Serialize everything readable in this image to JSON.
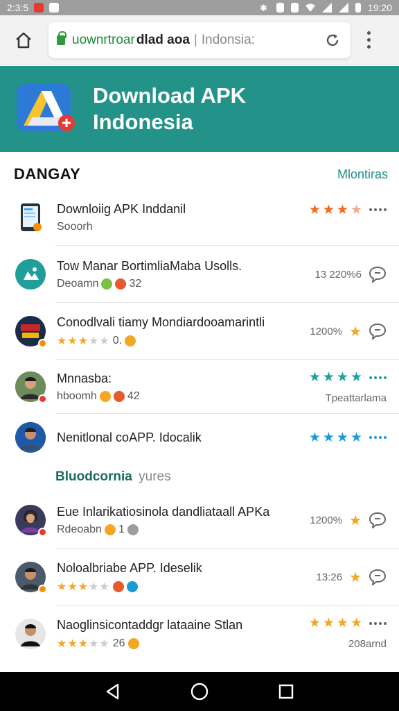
{
  "status_bar": {
    "time_left": "2:3:5",
    "time_right": "19:20"
  },
  "browser": {
    "url_host": "uownrtroar",
    "url_path": "dlad aoa",
    "url_sep": "|",
    "url_title": "Indonsia:"
  },
  "hero": {
    "title_line1": "Download APK",
    "title_line2": "Indonesia"
  },
  "section": {
    "title": "DANGAY",
    "link": "Mlontiras"
  },
  "list1": [
    {
      "title": "Downloiig APK Inddanil",
      "sub": "Sooorh",
      "right_type": "stars-dots",
      "stars": 3.5
    },
    {
      "title": "Tow Manar BortimliaMaba Usolls.",
      "sub": "Deoamn",
      "sub_num": "32",
      "meta": "13 220%6"
    },
    {
      "title": "Conodlvali tiamy Mondiardooamarintli",
      "sub_num": "0.",
      "meta": "1200%"
    },
    {
      "title": "Mnnasba:",
      "sub": "hboomh",
      "sub_num": "42",
      "meta": "Tpeattarlama"
    },
    {
      "title": "Nenitlonal coAPP. Idocalik"
    }
  ],
  "subheading": {
    "strong": "Bluodcornia",
    "light": "yures"
  },
  "list2": [
    {
      "title": "Eue Inlarikatiosinola dandliataall APKa",
      "sub": "Rdeoabn",
      "sub_num": "1",
      "meta": "1200%"
    },
    {
      "title": "Noloalbriabe APP. Ideselik",
      "meta": "13:26"
    },
    {
      "title": "Naoglinsicontaddgr lataaine Stlan",
      "sub_num": "26",
      "meta": "208arnd"
    }
  ],
  "colors": {
    "accent": "#23938a",
    "star": "#f5a623",
    "orange_star": "#ef6c1a",
    "teal_star": "#1aa1a0",
    "blue_star": "#1a9ad6"
  },
  "icons": [
    "home-icon",
    "lock-icon",
    "reload-icon",
    "overflow-menu-icon",
    "back-icon",
    "home-circle-icon",
    "recents-icon",
    "chat-icon"
  ]
}
